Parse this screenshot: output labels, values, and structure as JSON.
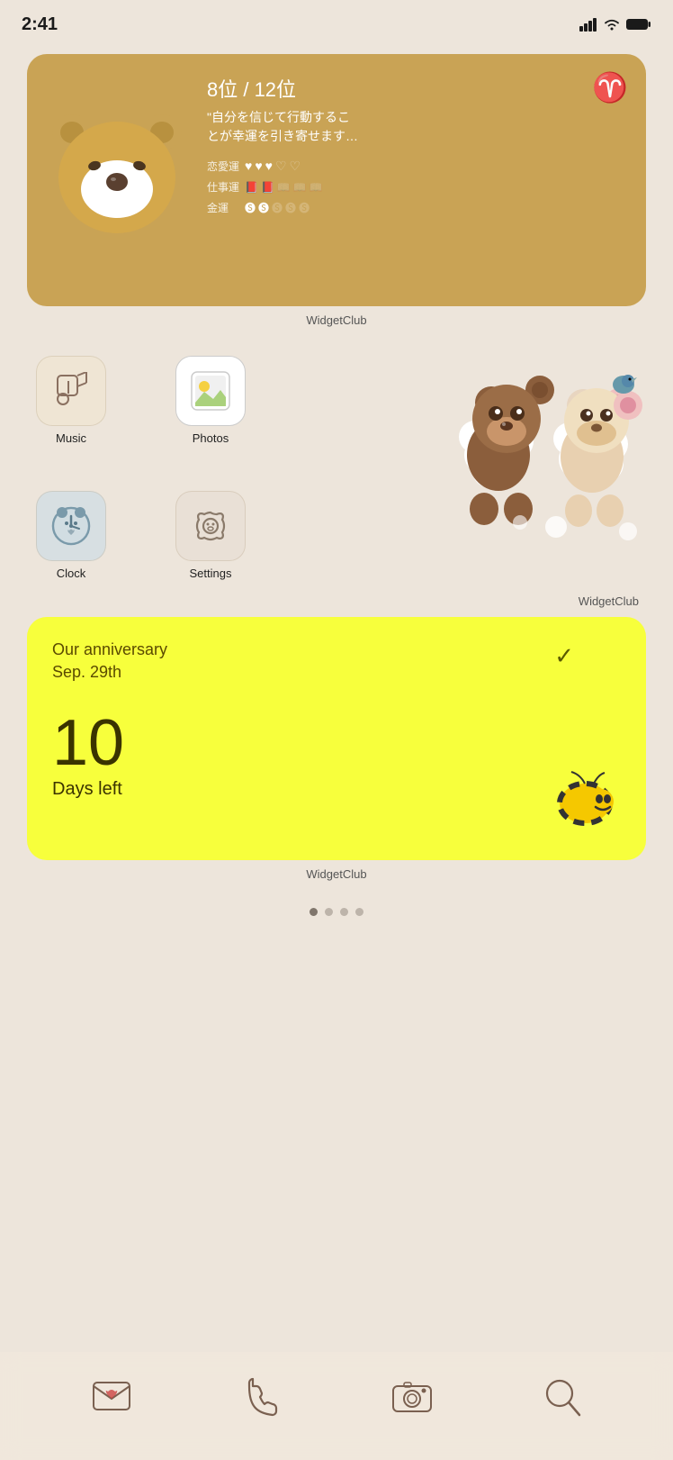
{
  "statusBar": {
    "time": "2:41",
    "signal": "signal-icon",
    "wifi": "wifi-icon",
    "battery": "battery-icon"
  },
  "horoscopeWidget": {
    "rank": "8位 / 12位",
    "ariesSymbol": "♈",
    "quote": "\"自分を信じて行動するこ\nとが幸運を引き寄せます…",
    "fortuneRows": [
      {
        "label": "恋愛運",
        "filled": 3,
        "empty": 2,
        "iconFilled": "♥",
        "iconEmpty": "♡"
      },
      {
        "label": "仕事運",
        "filled": 2,
        "empty": 3,
        "iconFilled": "📖",
        "iconEmpty": "📗"
      },
      {
        "label": "金運",
        "filled": 2,
        "empty": 3,
        "iconFilled": "💰",
        "iconEmpty": "💰"
      }
    ],
    "widgetLabel": "WidgetClub"
  },
  "apps": [
    {
      "id": "music",
      "label": "Music",
      "icon": "music"
    },
    {
      "id": "photos",
      "label": "Photos",
      "icon": "photos"
    },
    {
      "id": "clock",
      "label": "Clock",
      "icon": "clock"
    },
    {
      "id": "settings",
      "label": "Settings",
      "icon": "settings"
    }
  ],
  "widgetClubLabel1": "WidgetClub",
  "anniversaryWidget": {
    "title": "Our anniversary\nSep. 29th",
    "days": "10",
    "sublabel": "Days left",
    "widgetLabel": "WidgetClub"
  },
  "pageDots": [
    true,
    false,
    false,
    false
  ],
  "dock": {
    "items": [
      {
        "id": "messages",
        "icon": "mail"
      },
      {
        "id": "phone",
        "icon": "phone"
      },
      {
        "id": "camera",
        "icon": "camera"
      },
      {
        "id": "search",
        "icon": "search"
      }
    ]
  }
}
